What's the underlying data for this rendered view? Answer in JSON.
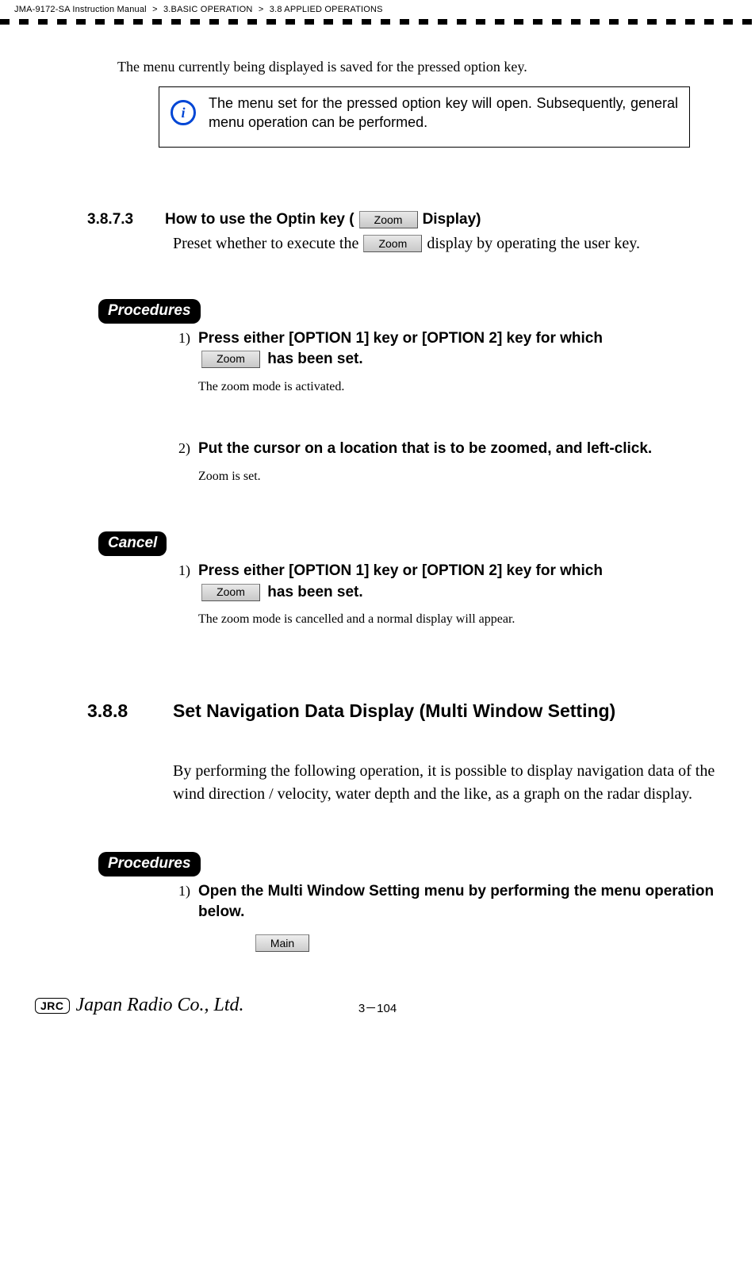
{
  "header": {
    "manual": "JMA-9172-SA Instruction Manual",
    "crumb1": "3.BASIC OPERATION",
    "crumb2": "3.8  APPLIED OPERATIONS",
    "sep": ">"
  },
  "intro_para": "The menu currently being displayed is saved for the pressed option key.",
  "info_icon": "i",
  "info_text": "The menu set for the pressed option key will open. Subsequently, general menu operation can be performed.",
  "sec3873": {
    "num": "3.8.7.3",
    "title_before": "How to use the Optin key (",
    "title_after": " Display)",
    "preset_before": "Preset whether to execute the ",
    "preset_after": " display by operating the user key."
  },
  "zoom_label": "Zoom",
  "pill_procedures": "Procedures",
  "pill_cancel": "Cancel",
  "proc1": {
    "num": "1)",
    "line1": " Press either [OPTION 1] key or [OPTION 2] key for which ",
    "line2": " has been set.",
    "sub": "The zoom mode is activated."
  },
  "proc2": {
    "num": "2)",
    "line": "Put the cursor on a location that is to be zoomed, and left-click.",
    "sub": "Zoom is set."
  },
  "cancel1": {
    "num": "1)",
    "line1": "Press either [OPTION 1] key or [OPTION 2] key for which ",
    "line2": " has been set.",
    "sub": "The zoom mode is cancelled and a normal display will appear."
  },
  "sec388": {
    "num": "3.8.8",
    "title": "Set Navigation Data Display (Multi Window Setting)",
    "para": "By performing the following operation, it is possible to display navigation data of the wind direction / velocity, water depth and the like, as a graph on the radar display."
  },
  "proc388": {
    "num": "1)",
    "line": "Open the Multi Window Setting menu by performing the menu operation below."
  },
  "main_label": "Main",
  "footer": {
    "jrc": "JRC",
    "company": "Japan Radio Co., Ltd.",
    "page": "3－104"
  }
}
